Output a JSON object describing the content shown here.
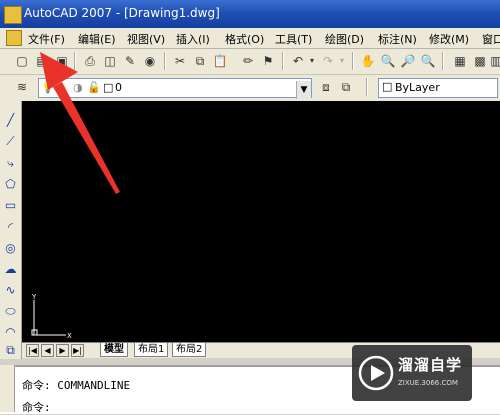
{
  "window": {
    "title": "AutoCAD 2007 - [Drawing1.dwg]"
  },
  "menu": [
    "文件(F)",
    "编辑(E)",
    "视图(V)",
    "插入(I)",
    "格式(O)",
    "工具(T)",
    "绘图(D)",
    "标注(N)",
    "修改(M)",
    "窗口"
  ],
  "layer_toolbar": {
    "current_layer": "0",
    "color_value": "ByLayer"
  },
  "layout_tabs": [
    "模型",
    "布局1",
    "布局2"
  ],
  "ucs": {
    "x_label": "X",
    "y_label": "Y"
  },
  "command": {
    "line1_prefix": "命令:",
    "line1_text": "COMMANDLINE",
    "line2_prefix": "命令:"
  },
  "watermark": {
    "name": "溜溜自学",
    "url": "ZIXUE.3066.COM"
  },
  "colors": {
    "canvas": "#000000",
    "title_bar": "#1f4fb5",
    "arrow": "#e8322a"
  }
}
